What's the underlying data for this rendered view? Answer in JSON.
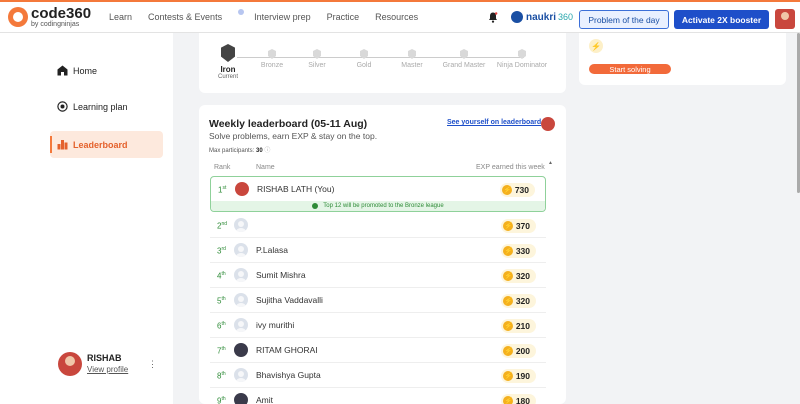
{
  "header": {
    "logo_title": "code360",
    "logo_sub": "by codingninjas",
    "nav": [
      "Learn",
      "Contests & Events",
      "Interview prep",
      "Practice",
      "Resources"
    ],
    "naukri_label": "naukri",
    "naukri_360": "360",
    "potd_label": "Problem of the day",
    "booster_label": "Activate 2X booster"
  },
  "sidebar": {
    "items": [
      {
        "label": "Home",
        "icon": "home-icon"
      },
      {
        "label": "Learning plan",
        "icon": "target-icon"
      },
      {
        "label": "Leaderboard",
        "icon": "leaderboard-icon"
      }
    ],
    "user_name": "RISHAB",
    "view_profile": "View profile",
    "more": "⋮"
  },
  "leagues": [
    {
      "name": "Iron",
      "current": "Current"
    },
    {
      "name": "Bronze"
    },
    {
      "name": "Silver"
    },
    {
      "name": "Gold"
    },
    {
      "name": "Master"
    },
    {
      "name": "Grand Master"
    },
    {
      "name": "Ninja Dominator"
    }
  ],
  "right_card": {
    "start_label": "Start solving"
  },
  "leaderboard": {
    "title": "Weekly leaderboard (05-11 Aug)",
    "subtitle": "Solve problems, earn EXP & stay on the top.",
    "max_label": "Max participants:",
    "max_value": "30",
    "see_yourself": "See yourself on leaderboard",
    "col_rank": "Rank",
    "col_name": "Name",
    "col_exp": "EXP earned this week",
    "promo_text": "Top 12 will be promoted to the Bronze league",
    "rows": [
      {
        "rank": "1",
        "sup": "st",
        "name": "RISHAB LATH (You)",
        "exp": "730"
      },
      {
        "rank": "2",
        "sup": "nd",
        "name": "",
        "exp": "370"
      },
      {
        "rank": "3",
        "sup": "rd",
        "name": "P.Lalasa",
        "exp": "330"
      },
      {
        "rank": "4",
        "sup": "th",
        "name": "Sumit Mishra",
        "exp": "320"
      },
      {
        "rank": "5",
        "sup": "th",
        "name": "Sujitha Vaddavalli",
        "exp": "320"
      },
      {
        "rank": "6",
        "sup": "th",
        "name": "ivy murithi",
        "exp": "210"
      },
      {
        "rank": "7",
        "sup": "th",
        "name": "RITAM GHORAI",
        "exp": "200"
      },
      {
        "rank": "8",
        "sup": "th",
        "name": "Bhavishya Gupta",
        "exp": "190"
      },
      {
        "rank": "9",
        "sup": "th",
        "name": "Amit",
        "exp": "180"
      }
    ]
  },
  "colors": {
    "accent": "#f4793b",
    "primary": "#1e4fc9",
    "rank_green": "#2e8b37"
  }
}
